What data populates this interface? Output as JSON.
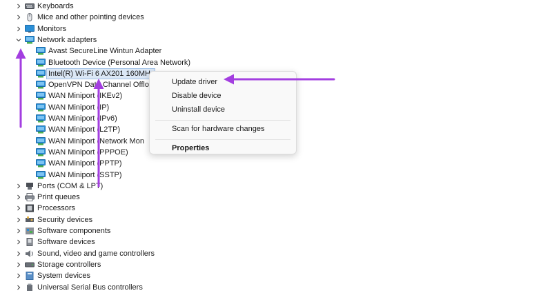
{
  "tree": {
    "categories_top": [
      {
        "label": "Keyboards",
        "icon": "keyboard-icon",
        "expanded": false
      },
      {
        "label": "Mice and other pointing devices",
        "icon": "mouse-icon",
        "expanded": false
      },
      {
        "label": "Monitors",
        "icon": "monitor-icon",
        "expanded": false
      },
      {
        "label": "Network adapters",
        "icon": "network-adapter-icon",
        "expanded": true
      }
    ],
    "network_adapters": [
      "Avast SecureLine Wintun Adapter",
      "Bluetooth Device (Personal Area Network)",
      "Intel(R) Wi-Fi 6 AX201 160MH-",
      "OpenVPN Data Channel Offlo",
      "WAN Miniport (IKEv2)",
      "WAN Miniport (IP)",
      "WAN Miniport (IPv6)",
      "WAN Miniport (L2TP)",
      "WAN Miniport (Network Mon",
      "WAN Miniport (PPPOE)",
      "WAN Miniport (PPTP)",
      "WAN Miniport (SSTP)"
    ],
    "selected_adapter": "Intel(R) Wi-Fi 6 AX201 160MH-",
    "categories_bottom": [
      {
        "label": "Ports (COM & LPT)",
        "icon": "port-icon"
      },
      {
        "label": "Print queues",
        "icon": "printer-icon"
      },
      {
        "label": "Processors",
        "icon": "processor-icon"
      },
      {
        "label": "Security devices",
        "icon": "security-device-icon"
      },
      {
        "label": "Software components",
        "icon": "software-component-icon"
      },
      {
        "label": "Software devices",
        "icon": "software-device-icon"
      },
      {
        "label": "Sound, video and game controllers",
        "icon": "speaker-icon"
      },
      {
        "label": "Storage controllers",
        "icon": "storage-controller-icon"
      },
      {
        "label": "System devices",
        "icon": "system-device-icon"
      },
      {
        "label": "Universal Serial Bus controllers",
        "icon": "usb-icon"
      }
    ]
  },
  "context_menu": {
    "update_driver": "Update driver",
    "disable_device": "Disable device",
    "uninstall_device": "Uninstall device",
    "scan_hardware": "Scan for hardware changes",
    "properties": "Properties"
  },
  "colors": {
    "arrow": "#a33ee0",
    "network_icon": "#2b8fd6",
    "selection": "#dbe7f5"
  }
}
